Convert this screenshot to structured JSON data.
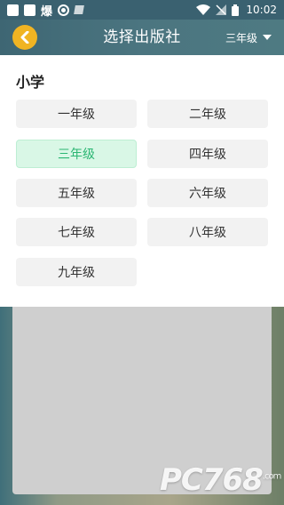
{
  "status_bar": {
    "glyph": "爆",
    "time": "10:02",
    "icons": [
      "square-icon",
      "square-icon",
      "target-icon",
      "album-icon",
      "wifi-icon",
      "signal-icon",
      "battery-icon"
    ]
  },
  "header": {
    "title": "选择出版社",
    "back_icon": "chevron-left-icon",
    "grade_selected": "三年级",
    "accent_color": "#f0b423"
  },
  "panel": {
    "section_title": "小学",
    "grades": [
      {
        "label": "一年级",
        "selected": false
      },
      {
        "label": "二年级",
        "selected": false
      },
      {
        "label": "三年级",
        "selected": true
      },
      {
        "label": "四年级",
        "selected": false
      },
      {
        "label": "五年级",
        "selected": false
      },
      {
        "label": "六年级",
        "selected": false
      },
      {
        "label": "七年级",
        "selected": false
      },
      {
        "label": "八年级",
        "selected": false
      },
      {
        "label": "九年级",
        "selected": false
      }
    ],
    "selected_color": "#2bb673"
  },
  "watermark": {
    "text": "PC768",
    "subtext": ".com"
  }
}
